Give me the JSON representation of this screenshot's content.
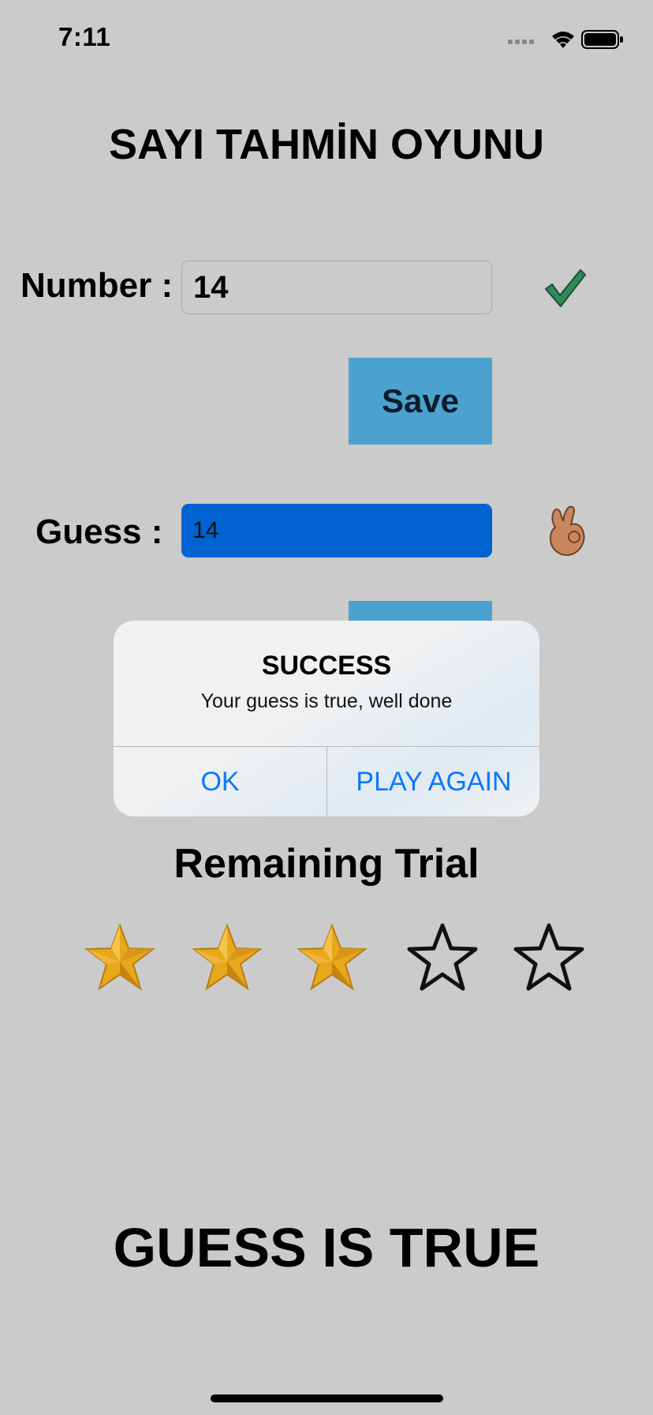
{
  "status": {
    "time": "7:11"
  },
  "title": "SAYI TAHMİN OYUNU",
  "number": {
    "label": "Number :",
    "value": "14",
    "save_label": "Save"
  },
  "guess": {
    "label": "Guess :",
    "value": "14"
  },
  "alert": {
    "title": "SUCCESS",
    "message": "Your guess is true, well done",
    "ok_label": "OK",
    "play_again_label": "PLAY AGAIN"
  },
  "remaining": {
    "label": "Remaining Trial",
    "filled": 3,
    "total": 5
  },
  "result": "GUESS IS TRUE",
  "colors": {
    "background": "#cbcbcb",
    "button": "#4ba2cf",
    "guess_field": "#0063d1",
    "alert_action": "#0a78ff",
    "star_gold": "#e8a81c",
    "checkmark": "#2f8a5a"
  }
}
